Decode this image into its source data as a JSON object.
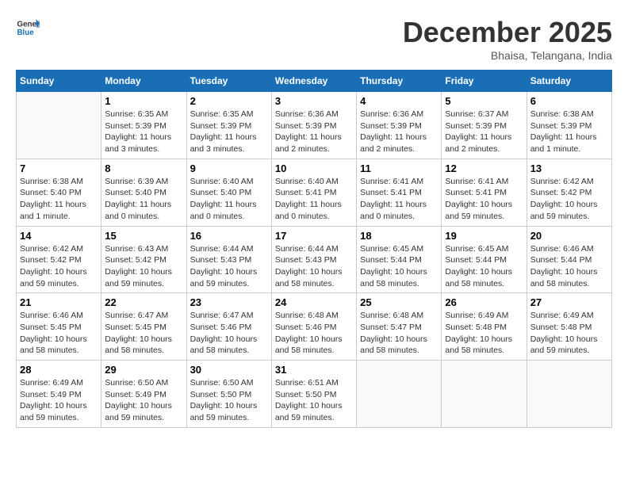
{
  "header": {
    "logo_general": "General",
    "logo_blue": "Blue",
    "month": "December 2025",
    "location": "Bhaisa, Telangana, India"
  },
  "weekdays": [
    "Sunday",
    "Monday",
    "Tuesday",
    "Wednesday",
    "Thursday",
    "Friday",
    "Saturday"
  ],
  "weeks": [
    [
      {
        "day": "",
        "info": ""
      },
      {
        "day": "1",
        "info": "Sunrise: 6:35 AM\nSunset: 5:39 PM\nDaylight: 11 hours\nand 3 minutes."
      },
      {
        "day": "2",
        "info": "Sunrise: 6:35 AM\nSunset: 5:39 PM\nDaylight: 11 hours\nand 3 minutes."
      },
      {
        "day": "3",
        "info": "Sunrise: 6:36 AM\nSunset: 5:39 PM\nDaylight: 11 hours\nand 2 minutes."
      },
      {
        "day": "4",
        "info": "Sunrise: 6:36 AM\nSunset: 5:39 PM\nDaylight: 11 hours\nand 2 minutes."
      },
      {
        "day": "5",
        "info": "Sunrise: 6:37 AM\nSunset: 5:39 PM\nDaylight: 11 hours\nand 2 minutes."
      },
      {
        "day": "6",
        "info": "Sunrise: 6:38 AM\nSunset: 5:39 PM\nDaylight: 11 hours\nand 1 minute."
      }
    ],
    [
      {
        "day": "7",
        "info": "Sunrise: 6:38 AM\nSunset: 5:40 PM\nDaylight: 11 hours\nand 1 minute."
      },
      {
        "day": "8",
        "info": "Sunrise: 6:39 AM\nSunset: 5:40 PM\nDaylight: 11 hours\nand 0 minutes."
      },
      {
        "day": "9",
        "info": "Sunrise: 6:40 AM\nSunset: 5:40 PM\nDaylight: 11 hours\nand 0 minutes."
      },
      {
        "day": "10",
        "info": "Sunrise: 6:40 AM\nSunset: 5:41 PM\nDaylight: 11 hours\nand 0 minutes."
      },
      {
        "day": "11",
        "info": "Sunrise: 6:41 AM\nSunset: 5:41 PM\nDaylight: 11 hours\nand 0 minutes."
      },
      {
        "day": "12",
        "info": "Sunrise: 6:41 AM\nSunset: 5:41 PM\nDaylight: 10 hours\nand 59 minutes."
      },
      {
        "day": "13",
        "info": "Sunrise: 6:42 AM\nSunset: 5:42 PM\nDaylight: 10 hours\nand 59 minutes."
      }
    ],
    [
      {
        "day": "14",
        "info": "Sunrise: 6:42 AM\nSunset: 5:42 PM\nDaylight: 10 hours\nand 59 minutes."
      },
      {
        "day": "15",
        "info": "Sunrise: 6:43 AM\nSunset: 5:42 PM\nDaylight: 10 hours\nand 59 minutes."
      },
      {
        "day": "16",
        "info": "Sunrise: 6:44 AM\nSunset: 5:43 PM\nDaylight: 10 hours\nand 59 minutes."
      },
      {
        "day": "17",
        "info": "Sunrise: 6:44 AM\nSunset: 5:43 PM\nDaylight: 10 hours\nand 58 minutes."
      },
      {
        "day": "18",
        "info": "Sunrise: 6:45 AM\nSunset: 5:44 PM\nDaylight: 10 hours\nand 58 minutes."
      },
      {
        "day": "19",
        "info": "Sunrise: 6:45 AM\nSunset: 5:44 PM\nDaylight: 10 hours\nand 58 minutes."
      },
      {
        "day": "20",
        "info": "Sunrise: 6:46 AM\nSunset: 5:44 PM\nDaylight: 10 hours\nand 58 minutes."
      }
    ],
    [
      {
        "day": "21",
        "info": "Sunrise: 6:46 AM\nSunset: 5:45 PM\nDaylight: 10 hours\nand 58 minutes."
      },
      {
        "day": "22",
        "info": "Sunrise: 6:47 AM\nSunset: 5:45 PM\nDaylight: 10 hours\nand 58 minutes."
      },
      {
        "day": "23",
        "info": "Sunrise: 6:47 AM\nSunset: 5:46 PM\nDaylight: 10 hours\nand 58 minutes."
      },
      {
        "day": "24",
        "info": "Sunrise: 6:48 AM\nSunset: 5:46 PM\nDaylight: 10 hours\nand 58 minutes."
      },
      {
        "day": "25",
        "info": "Sunrise: 6:48 AM\nSunset: 5:47 PM\nDaylight: 10 hours\nand 58 minutes."
      },
      {
        "day": "26",
        "info": "Sunrise: 6:49 AM\nSunset: 5:48 PM\nDaylight: 10 hours\nand 58 minutes."
      },
      {
        "day": "27",
        "info": "Sunrise: 6:49 AM\nSunset: 5:48 PM\nDaylight: 10 hours\nand 59 minutes."
      }
    ],
    [
      {
        "day": "28",
        "info": "Sunrise: 6:49 AM\nSunset: 5:49 PM\nDaylight: 10 hours\nand 59 minutes."
      },
      {
        "day": "29",
        "info": "Sunrise: 6:50 AM\nSunset: 5:49 PM\nDaylight: 10 hours\nand 59 minutes."
      },
      {
        "day": "30",
        "info": "Sunrise: 6:50 AM\nSunset: 5:50 PM\nDaylight: 10 hours\nand 59 minutes."
      },
      {
        "day": "31",
        "info": "Sunrise: 6:51 AM\nSunset: 5:50 PM\nDaylight: 10 hours\nand 59 minutes."
      },
      {
        "day": "",
        "info": ""
      },
      {
        "day": "",
        "info": ""
      },
      {
        "day": "",
        "info": ""
      }
    ]
  ]
}
